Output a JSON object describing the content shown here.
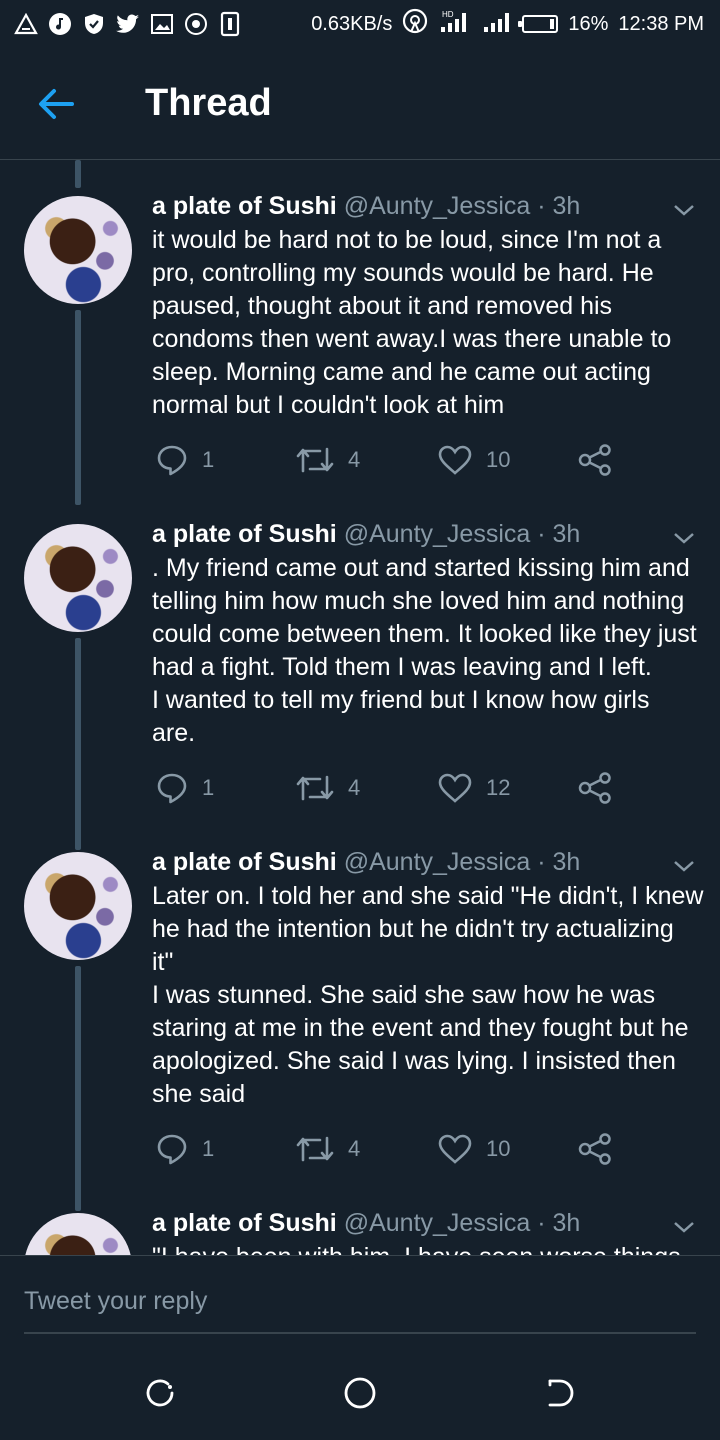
{
  "status_bar": {
    "left_icons": [
      "warning-icon",
      "music-icon",
      "shield-icon",
      "twitter-icon",
      "gallery-icon",
      "record-icon",
      "sim-icon"
    ],
    "speed": "0.63KB/s",
    "battery": "16%",
    "battery_level": 0.16,
    "time": "12:38 PM"
  },
  "header": {
    "title": "Thread",
    "back_icon": "arrow-left-icon"
  },
  "colors": {
    "background": "#15202b",
    "accent": "#1da1f2",
    "muted": "#8899a6",
    "divider": "#38444d"
  },
  "tweets": [
    {
      "name": "a plate of Sushi",
      "handle": "@Aunty_Jessica",
      "dot": "·",
      "time": "3h",
      "text": "it would be hard not to be loud, since I'm not a\npro, controlling my sounds would be hard. He\npaused, thought about it and removed his\ncondoms then went away.I was there unable to\nsleep. Morning came and he came out acting\nnormal but I couldn't look at him",
      "replies": "1",
      "retweets": "4",
      "likes": "10"
    },
    {
      "name": "a plate of Sushi",
      "handle": "@Aunty_Jessica",
      "dot": "·",
      "time": "3h",
      "text": ". My friend came out and started kissing him and\ntelling him how much she loved him and nothing\ncould come between them. It looked like they just\nhad a fight. Told them I was leaving and I left.\nI wanted to tell my friend but I know how girls\nare.",
      "replies": "1",
      "retweets": "4",
      "likes": "12"
    },
    {
      "name": "a plate of Sushi",
      "handle": "@Aunty_Jessica",
      "dot": "·",
      "time": "3h",
      "text": "Later on. I told her and she said \"He didn't, I knew\nhe had the intention but he didn't try actualizing\nit\"\nI was stunned. She said she saw how he was\nstaring at me in the event and they fought but he\napologized. She said I was lying. I insisted then\nshe said",
      "replies": "1",
      "retweets": "4",
      "likes": "10"
    },
    {
      "name": "a plate of Sushi",
      "handle": "@Aunty_Jessica",
      "dot": "·",
      "time": "3h",
      "text": "\"I have been with him, I have seen worse things"
    }
  ],
  "reply": {
    "placeholder": "Tweet your reply"
  },
  "nav": {
    "icons": [
      "recents-icon",
      "home-icon",
      "back-icon"
    ]
  }
}
